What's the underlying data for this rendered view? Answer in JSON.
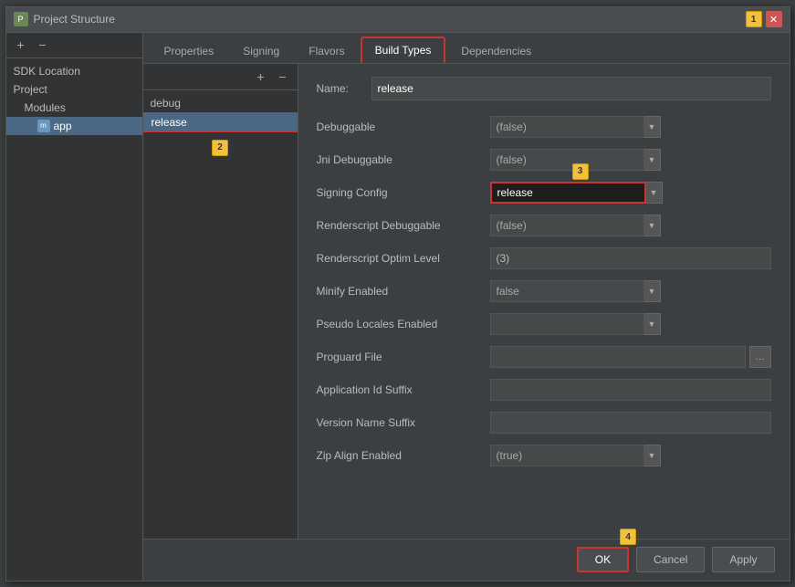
{
  "window": {
    "title": "Project Structure",
    "close_label": "✕"
  },
  "sidebar": {
    "add_label": "+",
    "remove_label": "−",
    "items": [
      {
        "label": "SDK Location",
        "type": "normal",
        "indent": 0
      },
      {
        "label": "Project",
        "type": "normal",
        "indent": 0
      },
      {
        "label": "Modules",
        "type": "normal",
        "indent": 1
      },
      {
        "label": "app",
        "type": "module",
        "indent": 2,
        "selected": true
      }
    ]
  },
  "tabs": [
    {
      "label": "Properties"
    },
    {
      "label": "Signing"
    },
    {
      "label": "Flavors"
    },
    {
      "label": "Build Types",
      "active": true
    },
    {
      "label": "Dependencies"
    }
  ],
  "build_list": {
    "add_label": "+",
    "remove_label": "−",
    "items": [
      {
        "label": "debug"
      },
      {
        "label": "release",
        "selected": true
      }
    ]
  },
  "form": {
    "name_label": "Name:",
    "name_value": "release",
    "fields": [
      {
        "label": "Debuggable",
        "type": "combo",
        "value": "(false)",
        "combo": true
      },
      {
        "label": "Jni Debuggable",
        "type": "combo",
        "value": "(false)",
        "combo": true
      },
      {
        "label": "Signing Config",
        "type": "combo_special",
        "value": "release",
        "combo": true
      },
      {
        "label": "Renderscript Debuggable",
        "type": "combo",
        "value": "(false)",
        "combo": true
      },
      {
        "label": "Renderscript Optim Level",
        "type": "text",
        "value": "(3)"
      },
      {
        "label": "Minify Enabled",
        "type": "combo",
        "value": "false",
        "combo": true
      },
      {
        "label": "Pseudo Locales Enabled",
        "type": "combo",
        "value": "",
        "combo": true
      },
      {
        "label": "Proguard File",
        "type": "proguard",
        "value": ""
      },
      {
        "label": "Application Id Suffix",
        "type": "text_input",
        "value": ""
      },
      {
        "label": "Version Name Suffix",
        "type": "text_input",
        "value": ""
      },
      {
        "label": "Zip Align Enabled",
        "type": "combo",
        "value": "(true)",
        "combo": true
      }
    ]
  },
  "buttons": {
    "ok_label": "OK",
    "cancel_label": "Cancel",
    "apply_label": "Apply"
  },
  "badges": {
    "b1": "1",
    "b2": "2",
    "b3": "3",
    "b4": "4"
  }
}
